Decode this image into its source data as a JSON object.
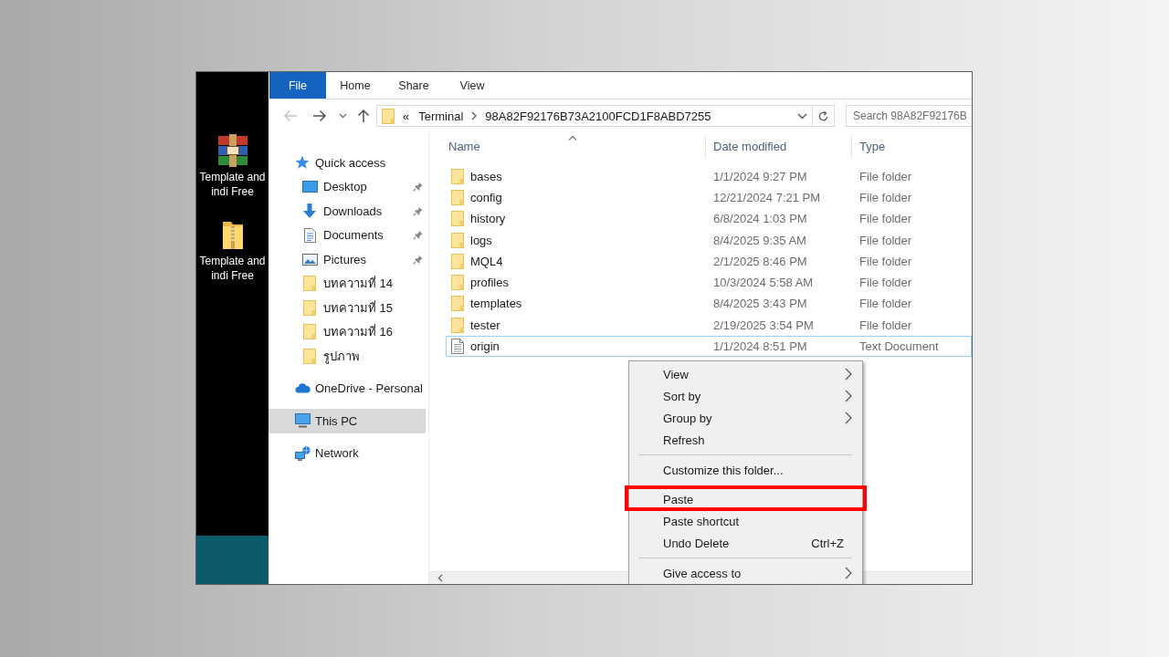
{
  "desktop": {
    "shortcuts": [
      {
        "label": "Template and indi Free",
        "kind": "archive"
      },
      {
        "label": "Template and indi Free",
        "kind": "zip"
      }
    ]
  },
  "ribbon": {
    "file_button": "File",
    "tabs": [
      "Home",
      "Share",
      "View"
    ]
  },
  "navigation_buttons": [
    {
      "kind": "back",
      "disabled": true
    },
    {
      "kind": "forward",
      "disabled": false
    },
    {
      "kind": "recent",
      "disabled": false
    },
    {
      "kind": "up",
      "disabled": false
    }
  ],
  "address_bar": {
    "overflow": "«",
    "path": [
      "Terminal",
      "98A82F92176B73A2100FCD1F8ABD7255"
    ]
  },
  "search": {
    "placeholder": "Search 98A82F92176B"
  },
  "navigation": [
    {
      "label": "Quick access",
      "kind": "quick",
      "selected": false,
      "pinned": false,
      "children": [
        {
          "label": "Desktop",
          "kind": "desktop",
          "selected": false,
          "pinned": true
        },
        {
          "label": "Downloads",
          "kind": "downloads",
          "selected": false,
          "pinned": true
        },
        {
          "label": "Documents",
          "kind": "documents",
          "selected": false,
          "pinned": true
        },
        {
          "label": "Pictures",
          "kind": "pictures",
          "selected": false,
          "pinned": true
        },
        {
          "label": "บทความที่ 14",
          "kind": "folder",
          "selected": false,
          "pinned": false
        },
        {
          "label": "บทความที่ 15",
          "kind": "folder",
          "selected": false,
          "pinned": false
        },
        {
          "label": "บทความที่ 16",
          "kind": "folder",
          "selected": false,
          "pinned": false
        },
        {
          "label": "รูปภาพ",
          "kind": "folder",
          "selected": false,
          "pinned": false
        }
      ]
    },
    {
      "label": "OneDrive - Personal",
      "kind": "cloud",
      "selected": false,
      "pinned": false
    },
    {
      "label": "This PC",
      "kind": "computer",
      "selected": true,
      "pinned": false
    },
    {
      "label": "Network",
      "kind": "network",
      "selected": false,
      "pinned": false
    }
  ],
  "columns": [
    {
      "label": "Name",
      "sorted": true
    },
    {
      "label": "Date modified",
      "sorted": false
    },
    {
      "label": "Type",
      "sorted": false
    }
  ],
  "files": [
    {
      "name": "bases",
      "date_modified": "1/1/2024 9:27 PM",
      "type": "File folder",
      "kind": "folder",
      "focused": false
    },
    {
      "name": "config",
      "date_modified": "12/21/2024 7:21 PM",
      "type": "File folder",
      "kind": "folder",
      "focused": false
    },
    {
      "name": "history",
      "date_modified": "6/8/2024 1:03 PM",
      "type": "File folder",
      "kind": "folder",
      "focused": false
    },
    {
      "name": "logs",
      "date_modified": "8/4/2025 9:35 AM",
      "type": "File folder",
      "kind": "folder",
      "focused": false
    },
    {
      "name": "MQL4",
      "date_modified": "2/1/2025 8:46 PM",
      "type": "File folder",
      "kind": "folder",
      "focused": false
    },
    {
      "name": "profiles",
      "date_modified": "10/3/2024 5:58 AM",
      "type": "File folder",
      "kind": "folder",
      "focused": false
    },
    {
      "name": "templates",
      "date_modified": "8/4/2025 3:43 PM",
      "type": "File folder",
      "kind": "folder",
      "focused": false
    },
    {
      "name": "tester",
      "date_modified": "2/19/2025 3:54 PM",
      "type": "File folder",
      "kind": "folder",
      "focused": false
    },
    {
      "name": "origin",
      "date_modified": "1/1/2024 8:51 PM",
      "type": "Text Document",
      "kind": "text",
      "focused": true
    }
  ],
  "context_menu": [
    {
      "kind": "item",
      "label": "View",
      "submenu": true,
      "highlighted": false
    },
    {
      "kind": "item",
      "label": "Sort by",
      "submenu": true,
      "highlighted": false
    },
    {
      "kind": "item",
      "label": "Group by",
      "submenu": true,
      "highlighted": false
    },
    {
      "kind": "item",
      "label": "Refresh",
      "submenu": false,
      "highlighted": false
    },
    {
      "kind": "separator"
    },
    {
      "kind": "item",
      "label": "Customize this folder...",
      "submenu": false,
      "highlighted": false
    },
    {
      "kind": "item",
      "label": "Paste",
      "submenu": false,
      "highlighted": true
    },
    {
      "kind": "item",
      "label": "Paste shortcut",
      "submenu": false,
      "highlighted": false
    },
    {
      "kind": "item",
      "label": "Undo Delete",
      "shortcut": "Ctrl+Z",
      "submenu": false,
      "highlighted": false
    },
    {
      "kind": "separator"
    },
    {
      "kind": "item",
      "label": "Give access to",
      "submenu": true,
      "highlighted": false
    }
  ]
}
